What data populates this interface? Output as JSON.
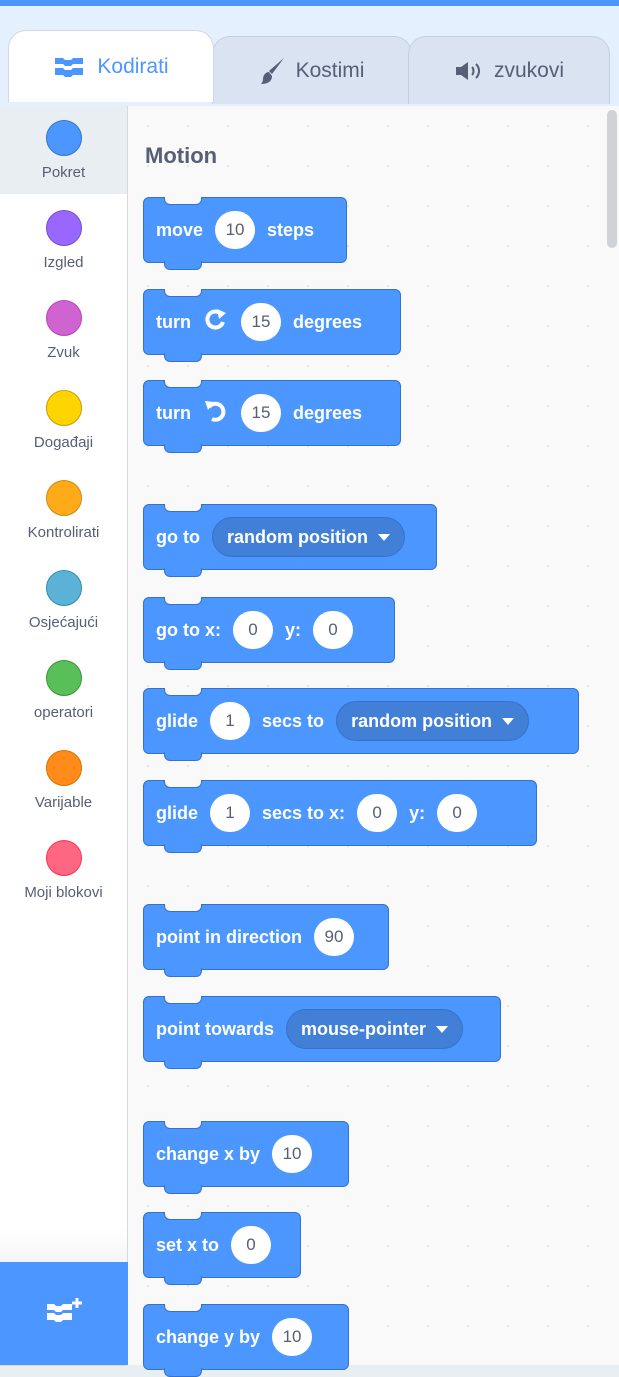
{
  "tabs": {
    "code": "Kodirati",
    "costumes": "Kostimi",
    "sounds": "zvukovi"
  },
  "colors": {
    "accent": "#4c97ff",
    "motion_block": "#4c97ff",
    "motion_block_border": "#3373cc"
  },
  "categories": [
    {
      "label": "Pokret",
      "color": "#4c97ff",
      "selected": true
    },
    {
      "label": "Izgled",
      "color": "#9966ff"
    },
    {
      "label": "Zvuk",
      "color": "#cf63cf"
    },
    {
      "label": "Događaji",
      "color": "#ffd500"
    },
    {
      "label": "Kontrolirati",
      "color": "#ffab19"
    },
    {
      "label": "Osjećajući",
      "color": "#5cb1d6"
    },
    {
      "label": "operatori",
      "color": "#59c059"
    },
    {
      "label": "Varijable",
      "color": "#ff8c1a"
    },
    {
      "label": "Moji blokovi",
      "color": "#ff6680"
    }
  ],
  "extension_button_icon": "add-extension-icon",
  "palette": {
    "section_title": "Motion",
    "blocks": {
      "move": {
        "text": "move",
        "value": "10",
        "suffix": "steps"
      },
      "turn_right": {
        "text": "turn",
        "icon": "rotate-right-icon",
        "value": "15",
        "suffix": "degrees"
      },
      "turn_left": {
        "text": "turn",
        "icon": "rotate-left-icon",
        "value": "15",
        "suffix": "degrees"
      },
      "go_to": {
        "text": "go to",
        "dropdown": "random position"
      },
      "go_to_xy": {
        "text": "go to x:",
        "x": "0",
        "y_label": "y:",
        "y": "0"
      },
      "glide_to": {
        "text": "glide",
        "value": "1",
        "mid": "secs to",
        "dropdown": "random position"
      },
      "glide_xy": {
        "text": "glide",
        "value": "1",
        "mid": "secs to x:",
        "x": "0",
        "y_label": "y:",
        "y": "0"
      },
      "point_direction": {
        "text": "point in direction",
        "value": "90"
      },
      "point_towards": {
        "text": "point towards",
        "dropdown": "mouse-pointer"
      },
      "change_x": {
        "text": "change x by",
        "value": "10"
      },
      "set_x": {
        "text": "set x to",
        "value": "0"
      },
      "change_y": {
        "text": "change y by",
        "value": "10"
      }
    }
  }
}
